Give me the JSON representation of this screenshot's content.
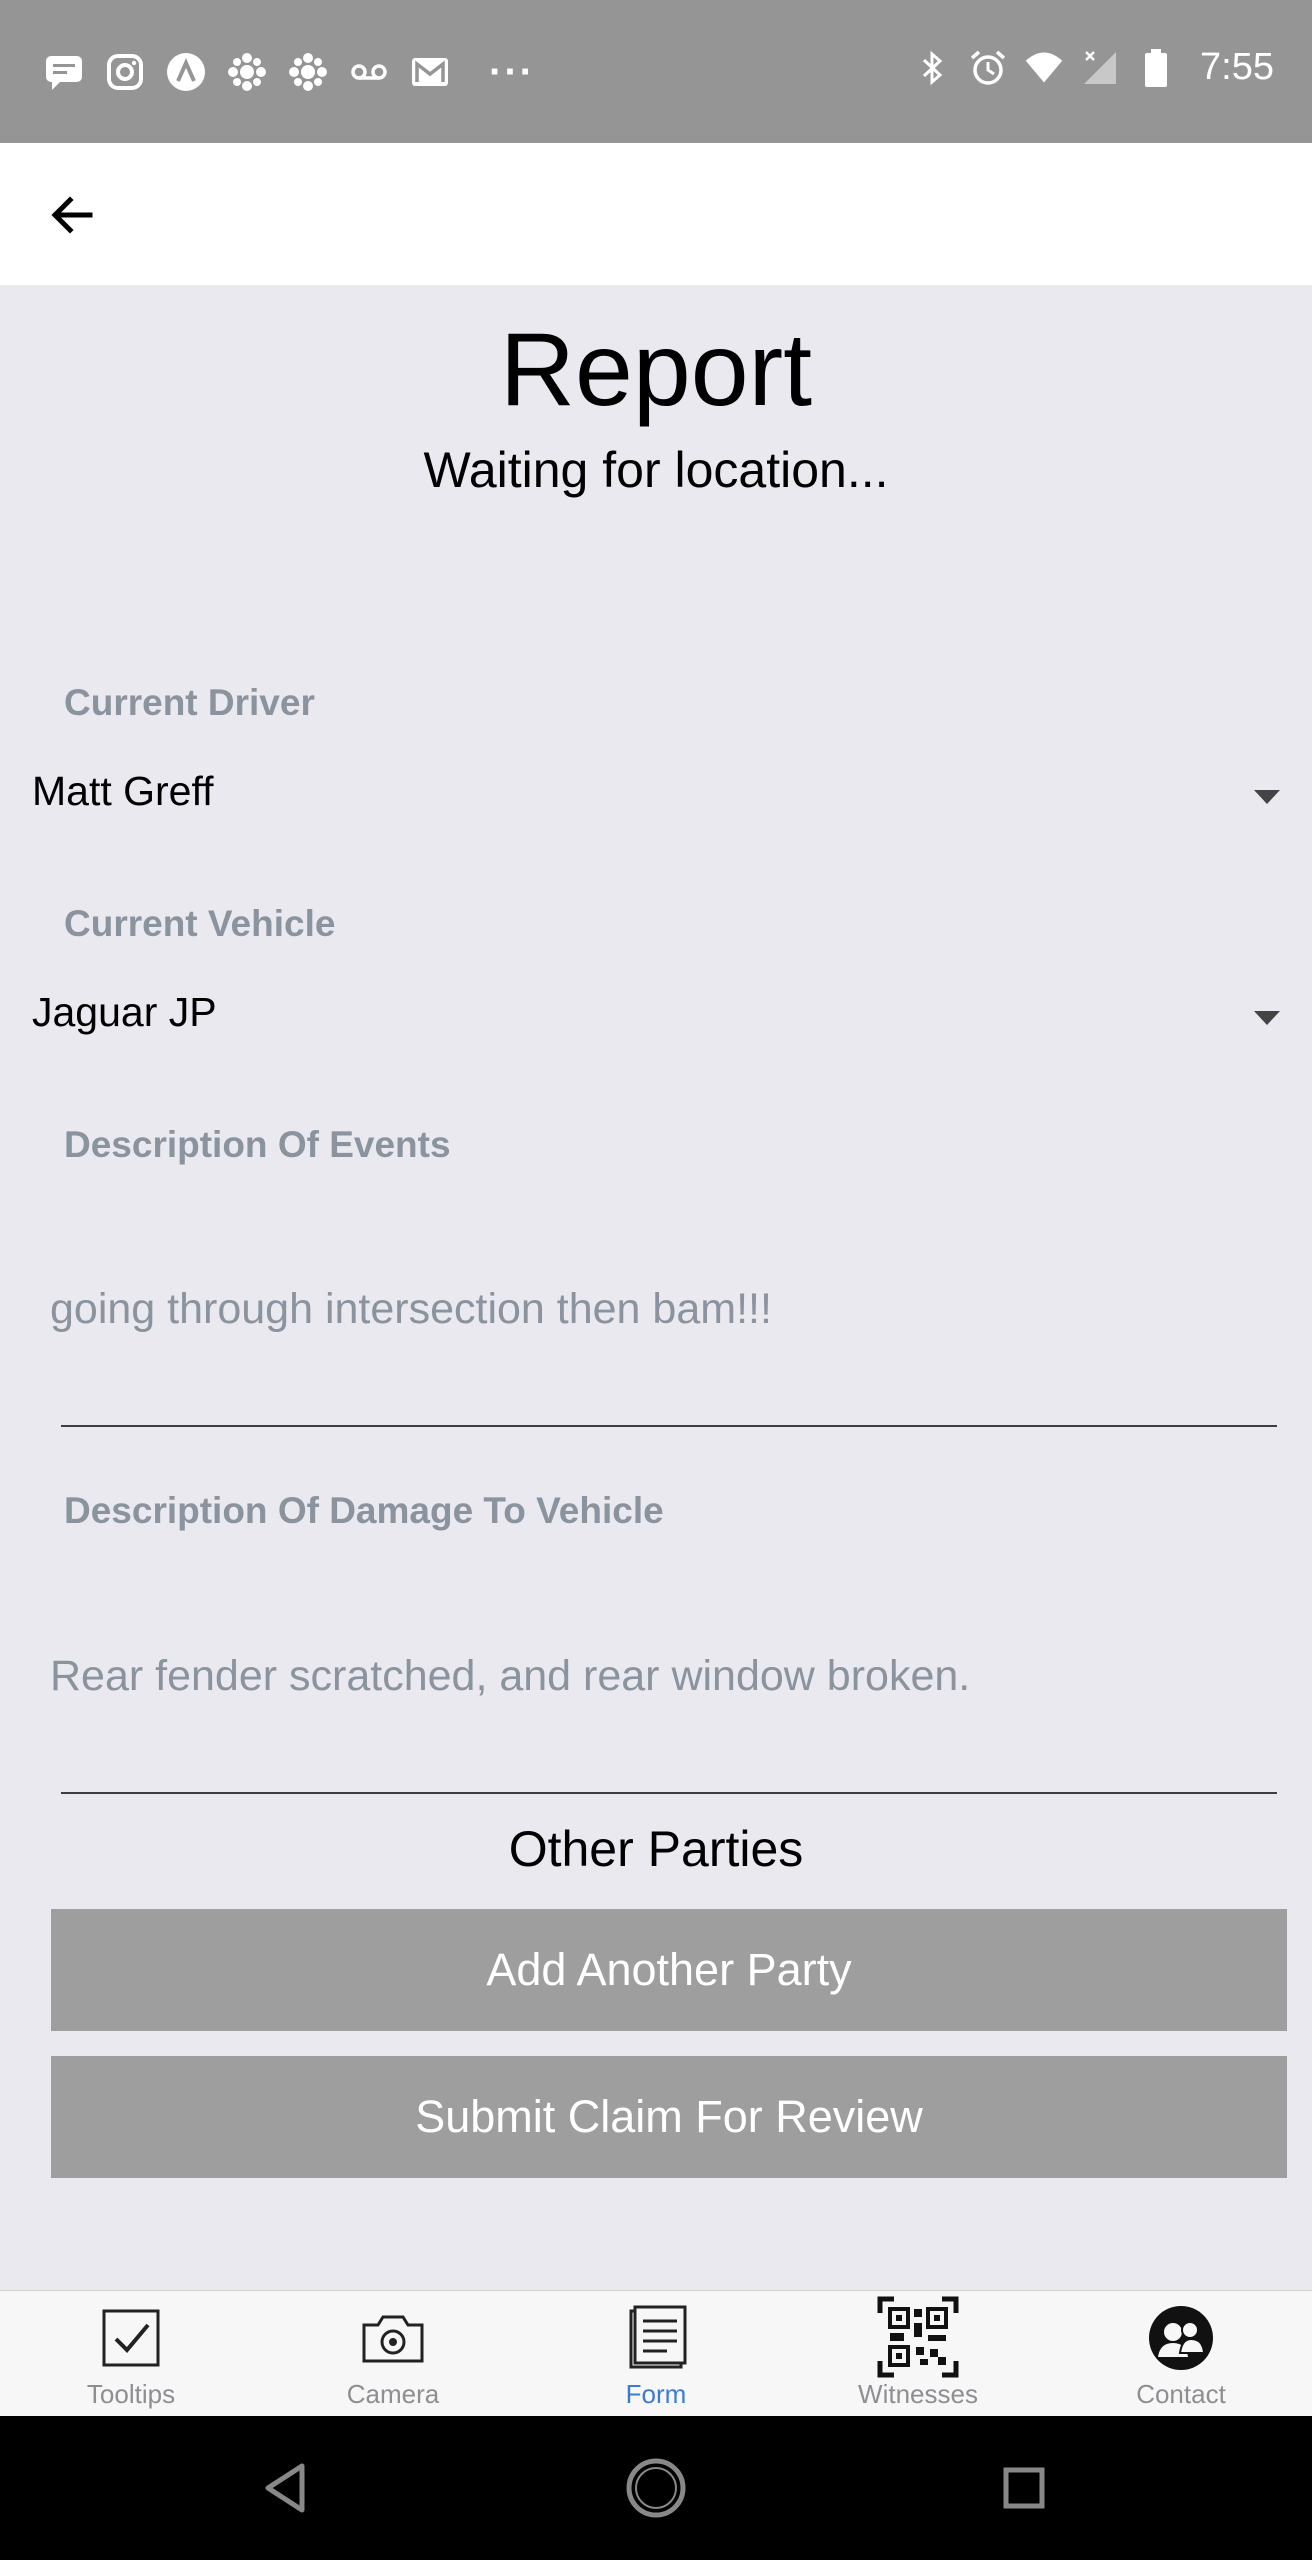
{
  "status_bar": {
    "time": "7:55",
    "left_icons": [
      "message-icon",
      "instagram-icon",
      "arrow-app-icon",
      "cbc-icon",
      "cbc-icon",
      "voicemail-icon",
      "gmail-icon"
    ],
    "overflow": "···",
    "right_icons": [
      "bluetooth-icon",
      "alarm-icon",
      "wifi-icon",
      "cell-signal-icon",
      "battery-icon"
    ]
  },
  "header": {
    "back_icon": "arrow-left-icon"
  },
  "page": {
    "title": "Report",
    "subtitle": "Waiting for location..."
  },
  "form": {
    "driver": {
      "label": "Current Driver",
      "value": "Matt Greff"
    },
    "vehicle": {
      "label": "Current Vehicle",
      "value": "Jaguar JP"
    },
    "events": {
      "label": "Description Of Events",
      "value": "going through intersection then bam!!!"
    },
    "damage": {
      "label": "Description Of Damage To Vehicle",
      "value": "Rear fender scratched, and rear window broken."
    }
  },
  "other_parties": {
    "heading": "Other Parties",
    "add_label": "Add Another Party",
    "submit_label": "Submit Claim For Review"
  },
  "tabs": [
    {
      "label": "Tooltips",
      "icon": "checkbox-icon",
      "active": false
    },
    {
      "label": "Camera",
      "icon": "camera-icon",
      "active": false
    },
    {
      "label": "Form",
      "icon": "form-icon",
      "active": true
    },
    {
      "label": "Witnesses",
      "icon": "qr-code-icon",
      "active": false
    },
    {
      "label": "Contact",
      "icon": "contact-icon",
      "active": false
    }
  ],
  "colors": {
    "active_tab": "#3b7bd4",
    "inactive_tab": "#8e8e93",
    "button_bg": "#9e9e9e",
    "label": "#8a939e"
  }
}
